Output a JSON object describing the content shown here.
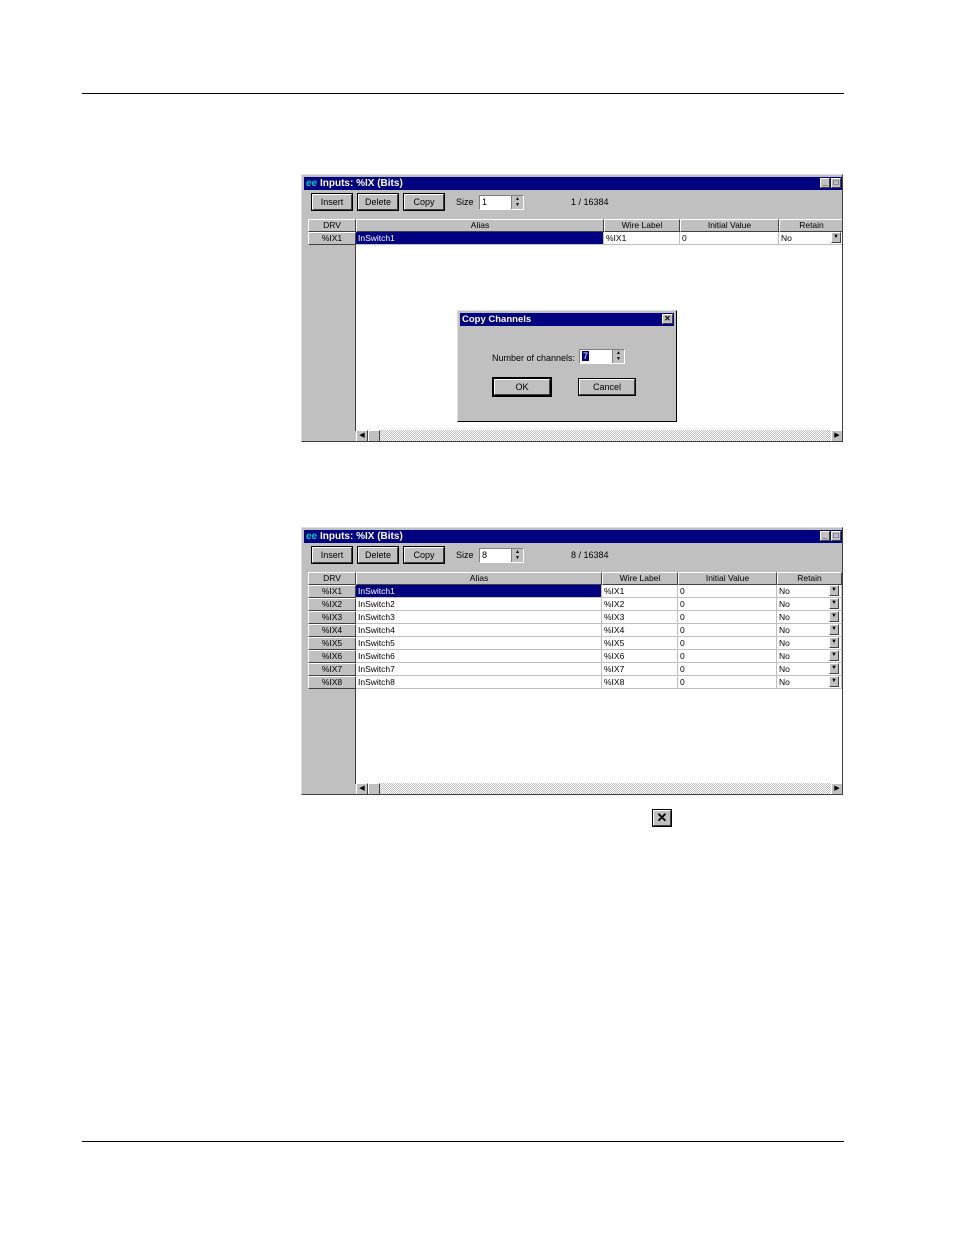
{
  "window1": {
    "title": "Inputs: %IX (Bits)",
    "toolbar": {
      "insert": "Insert",
      "delete": "Delete",
      "copy": "Copy",
      "size_label": "Size",
      "size_value": "1",
      "count": "1 / 16384"
    },
    "columns": {
      "drv": "DRV",
      "alias": "Alias",
      "wire": "Wire Label",
      "init": "Initial Value",
      "retain": "Retain"
    },
    "rows": [
      {
        "drv": "%IX1",
        "alias": "InSwitch1",
        "wire": "%IX1",
        "init": "0",
        "retain": "No"
      }
    ],
    "dialog": {
      "title": "Copy Channels",
      "label": "Number of channels:",
      "value": "7",
      "ok": "OK",
      "cancel": "Cancel"
    }
  },
  "window2": {
    "title": "Inputs: %IX (Bits)",
    "toolbar": {
      "insert": "Insert",
      "delete": "Delete",
      "copy": "Copy",
      "size_label": "Size",
      "size_value": "8",
      "count": "8 / 16384"
    },
    "columns": {
      "drv": "DRV",
      "alias": "Alias",
      "wire": "Wire Label",
      "init": "Initial Value",
      "retain": "Retain"
    },
    "rows": [
      {
        "drv": "%IX1",
        "alias": "InSwitch1",
        "wire": "%IX1",
        "init": "0",
        "retain": "No"
      },
      {
        "drv": "%IX2",
        "alias": "InSwitch2",
        "wire": "%IX2",
        "init": "0",
        "retain": "No"
      },
      {
        "drv": "%IX3",
        "alias": "InSwitch3",
        "wire": "%IX3",
        "init": "0",
        "retain": "No"
      },
      {
        "drv": "%IX4",
        "alias": "InSwitch4",
        "wire": "%IX4",
        "init": "0",
        "retain": "No"
      },
      {
        "drv": "%IX5",
        "alias": "InSwitch5",
        "wire": "%IX5",
        "init": "0",
        "retain": "No"
      },
      {
        "drv": "%IX6",
        "alias": "InSwitch6",
        "wire": "%IX6",
        "init": "0",
        "retain": "No"
      },
      {
        "drv": "%IX7",
        "alias": "InSwitch7",
        "wire": "%IX7",
        "init": "0",
        "retain": "No"
      },
      {
        "drv": "%IX8",
        "alias": "InSwitch8",
        "wire": "%IX8",
        "init": "0",
        "retain": "No"
      }
    ]
  },
  "icons": {
    "close": "close-icon",
    "minimize": "minimize-icon",
    "maximize": "maximize-icon",
    "dropdown": "chevron-down-icon"
  }
}
